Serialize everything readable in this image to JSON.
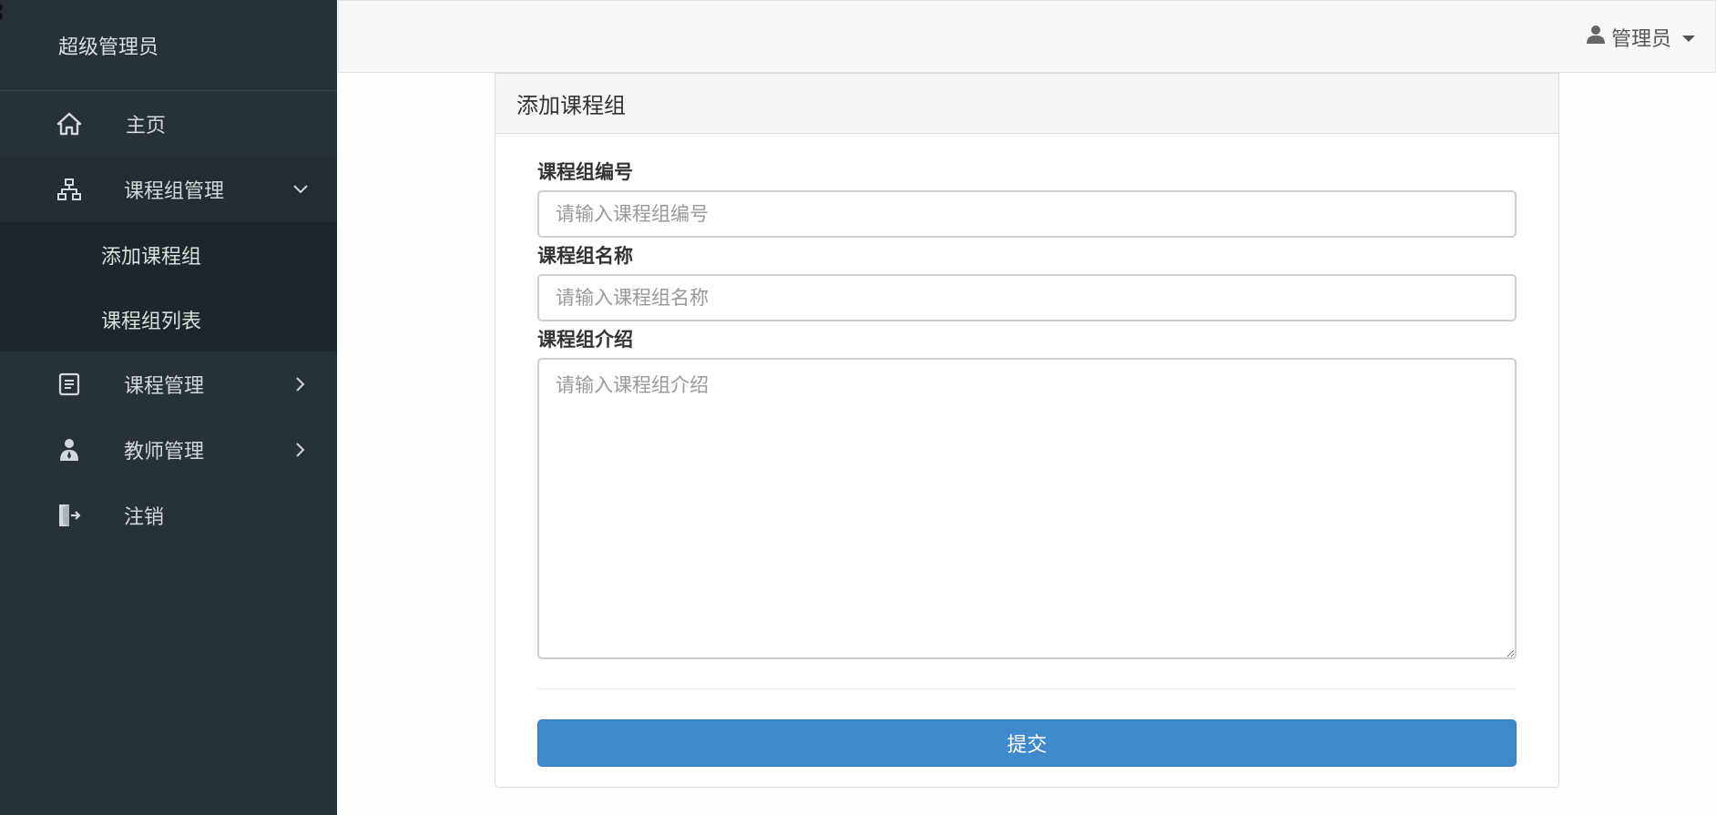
{
  "sidebar": {
    "user": "超级管理员",
    "items": [
      {
        "label": "主页",
        "icon": "home-icon"
      },
      {
        "label": "课程组管理",
        "icon": "sitemap-icon",
        "expanded": true,
        "children": [
          {
            "label": "添加课程组"
          },
          {
            "label": "课程组列表"
          }
        ]
      },
      {
        "label": "课程管理",
        "icon": "document-icon"
      },
      {
        "label": "教师管理",
        "icon": "teacher-icon"
      },
      {
        "label": "注销",
        "icon": "logout-icon"
      }
    ]
  },
  "topbar": {
    "user_label": "管理员",
    "user_icon": "user-icon"
  },
  "panel": {
    "title": "添加课程组",
    "fields": {
      "code": {
        "label": "课程组编号",
        "placeholder": "请输入课程组编号",
        "value": ""
      },
      "name": {
        "label": "课程组名称",
        "placeholder": "请输入课程组名称",
        "value": ""
      },
      "intro": {
        "label": "课程组介绍",
        "placeholder": "请输入课程组介绍",
        "value": ""
      }
    },
    "submit_label": "提交"
  },
  "colors": {
    "sidebar_bg": "#263238",
    "submenu_bg": "#1d262b",
    "primary": "#3e8acc"
  }
}
